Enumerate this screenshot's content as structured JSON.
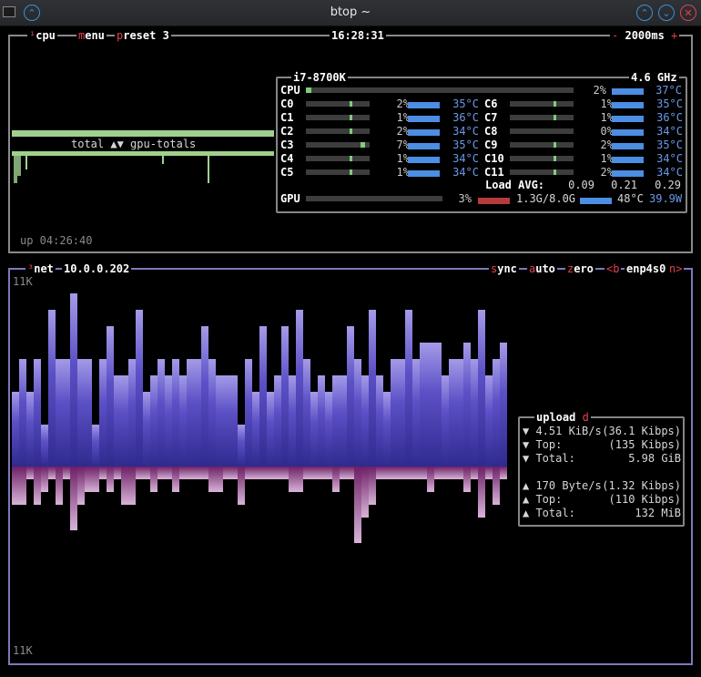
{
  "window": {
    "title": "btop ~"
  },
  "cpu_box": {
    "num": "¹",
    "label": "cpu",
    "menu": "menu",
    "preset": "preset 3",
    "clock": "16:28:31",
    "interval_minus": "-",
    "interval": "2000ms",
    "interval_plus": "+",
    "graph_label": "total ▲▼ gpu-totals",
    "uptime": "up 04:26:40",
    "model": "i7-8700K",
    "freq": "4.6 GHz",
    "total": {
      "name": "CPU",
      "pct": "2%",
      "temp": "37°C",
      "level": 0.02
    },
    "cores_left": [
      {
        "name": "C0",
        "pct": "2%",
        "temp": "35°C",
        "level": 0.02
      },
      {
        "name": "C1",
        "pct": "1%",
        "temp": "36°C",
        "level": 0.01
      },
      {
        "name": "C2",
        "pct": "2%",
        "temp": "34°C",
        "level": 0.02
      },
      {
        "name": "C3",
        "pct": "7%",
        "temp": "35°C",
        "level": 0.07
      },
      {
        "name": "C4",
        "pct": "1%",
        "temp": "34°C",
        "level": 0.01
      },
      {
        "name": "C5",
        "pct": "1%",
        "temp": "34°C",
        "level": 0.01
      }
    ],
    "cores_right": [
      {
        "name": "C6",
        "pct": "1%",
        "temp": "35°C",
        "level": 0.01
      },
      {
        "name": "C7",
        "pct": "1%",
        "temp": "36°C",
        "level": 0.01
      },
      {
        "name": "C8",
        "pct": "0%",
        "temp": "34°C",
        "level": 0.0
      },
      {
        "name": "C9",
        "pct": "2%",
        "temp": "35°C",
        "level": 0.02
      },
      {
        "name": "C10",
        "pct": "1%",
        "temp": "34°C",
        "level": 0.01
      },
      {
        "name": "C11",
        "pct": "2%",
        "temp": "34°C",
        "level": 0.02
      }
    ],
    "load_label": "Load AVG:",
    "load": [
      "0.09",
      "0.21",
      "0.29"
    ],
    "gpu": {
      "name": "GPU",
      "pct": "3%",
      "mem": "1.3G/8.0G",
      "temp": "48°C",
      "power": "39.9W"
    }
  },
  "net_box": {
    "num": "³",
    "label": "net",
    "ip": "10.0.0.202",
    "sync": "sync",
    "auto": "auto",
    "zero": "zero",
    "prev": "<b",
    "iface": "enp4s0",
    "next": "n>",
    "scale_top": "11K",
    "scale_bottom": "11K",
    "stats_title": "upload",
    "stats_title_key": "d",
    "download": {
      "rate": "▼ 4.51 KiB/s",
      "rate_bits": "(36.1 Kibps)",
      "top_label": "▼ Top:",
      "top": "(135 Kibps)",
      "total_label": "▼ Total:",
      "total": "5.98 GiB"
    },
    "upload": {
      "rate": "▲ 170 Byte/s",
      "rate_bits": "(1.32 Kibps)",
      "top_label": "▲ Top:",
      "top": "(110 Kibps)",
      "total_label": "▲ Total:",
      "total": "132 MiB"
    },
    "download_series": [
      4,
      6,
      4,
      6,
      2,
      9,
      6,
      6,
      10,
      6,
      6,
      2,
      6,
      8,
      5,
      5,
      6,
      9,
      4,
      5,
      6,
      5,
      6,
      5,
      6,
      6,
      8,
      6,
      5,
      5,
      5,
      2,
      6,
      4,
      8,
      4,
      5,
      8,
      5,
      9,
      6,
      4,
      5,
      4,
      5,
      5,
      8,
      6,
      5,
      9,
      5,
      4,
      6,
      6,
      9,
      6,
      7,
      7,
      7,
      5,
      6,
      6,
      7,
      6,
      9,
      5,
      6,
      7
    ],
    "upload_series": [
      3,
      3,
      1,
      3,
      2,
      1,
      3,
      1,
      5,
      3,
      2,
      2,
      1,
      2,
      1,
      3,
      3,
      1,
      1,
      2,
      1,
      1,
      2,
      1,
      1,
      1,
      1,
      2,
      2,
      1,
      1,
      3,
      1,
      1,
      1,
      1,
      1,
      1,
      2,
      2,
      1,
      1,
      1,
      1,
      2,
      1,
      1,
      6,
      4,
      3,
      1,
      1,
      1,
      1,
      1,
      1,
      1,
      2,
      1,
      1,
      1,
      1,
      2,
      1,
      4,
      1,
      3,
      1
    ]
  },
  "colors": {
    "cpu_border": "#8a8a8a",
    "net_border": "#7e78b8",
    "accent": "#e0424c",
    "graph_green": "#9fd18d",
    "download": "#5a4fc7",
    "upload": "#7c2a74"
  }
}
